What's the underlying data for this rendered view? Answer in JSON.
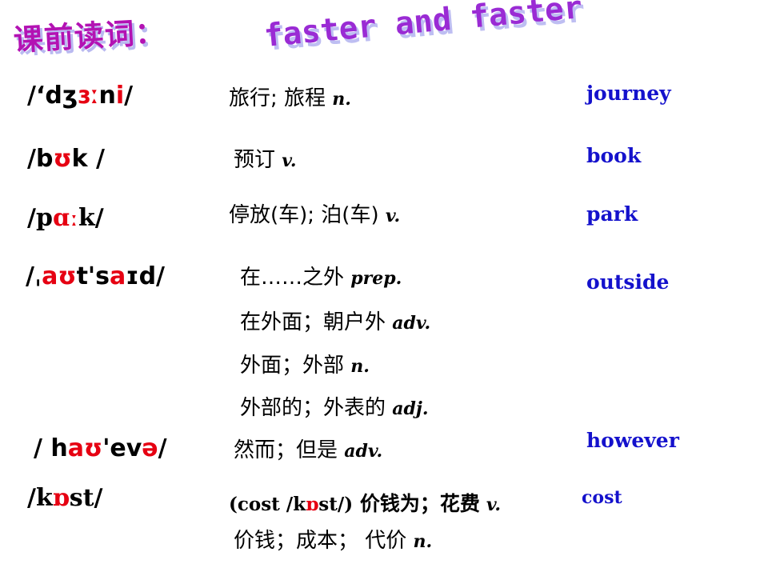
{
  "slide": {
    "background_color": "#ffffff",
    "title": {
      "chinese": "课前读词：",
      "english": "faster and faster",
      "chinese_color": "#B312B3",
      "english_color": "#9A2BD4",
      "shadow_color": "#BEBEF2"
    },
    "colors": {
      "phonetic_black": "#000000",
      "phonetic_highlight_red": "#E60012",
      "word_blue": "#1411CC"
    },
    "entries": [
      {
        "word": "journey",
        "phonetic": "/‘dʒɜːni/",
        "phonetic_segments": [
          {
            "text": "/‘d",
            "color": "black"
          },
          {
            "text": "ʒ",
            "color": "black"
          },
          {
            "text": "ɜː",
            "color": "red"
          },
          {
            "text": "n",
            "color": "black"
          },
          {
            "text": "i",
            "color": "red"
          },
          {
            "text": "/",
            "color": "black"
          }
        ],
        "definitions": [
          {
            "chinese": "旅行; 旅程",
            "pos": "n."
          }
        ]
      },
      {
        "word": "book",
        "phonetic": "/bʊk /",
        "phonetic_segments": [
          {
            "text": "/b",
            "color": "black"
          },
          {
            "text": "ʊ",
            "color": "red"
          },
          {
            "text": "k /",
            "color": "black"
          }
        ],
        "definitions": [
          {
            "chinese": "预订",
            "pos": "v."
          }
        ]
      },
      {
        "word": "park",
        "phonetic": "/pɑːk/",
        "phonetic_segments": [
          {
            "text": "/p",
            "color": "black"
          },
          {
            "text": "ɑː",
            "color": "red"
          },
          {
            "text": "k/",
            "color": "black"
          }
        ],
        "definitions": [
          {
            "chinese": "停放(车); 泊(车)",
            "pos": "v."
          }
        ]
      },
      {
        "word": "outside",
        "phonetic": "/ˌaʊtˈsaɪd/",
        "phonetic_segments": [
          {
            "text": "/ˌ",
            "color": "black"
          },
          {
            "text": "aʊ",
            "color": "red"
          },
          {
            "text": "t's",
            "color": "black"
          },
          {
            "text": "a",
            "color": "red"
          },
          {
            "text": "ɪd/",
            "color": "black"
          }
        ],
        "definitions": [
          {
            "chinese": "在……之外",
            "pos": "prep."
          },
          {
            "chinese": "在外面；朝户外",
            "pos": "adv."
          },
          {
            "chinese": "外面；外部",
            "pos": "n."
          },
          {
            "chinese": "外部的；外表的",
            "pos": "adj."
          }
        ]
      },
      {
        "word": "however",
        "phonetic": "/ haʊˈevə/",
        "phonetic_segments": [
          {
            "text": "/ h",
            "color": "black"
          },
          {
            "text": "aʊ",
            "color": "red"
          },
          {
            "text": "'ev",
            "color": "black"
          },
          {
            "text": "ə",
            "color": "red"
          },
          {
            "text": "/",
            "color": "black"
          }
        ],
        "definitions": [
          {
            "chinese": "然而；但是",
            "pos": "adv."
          }
        ]
      },
      {
        "word": "cost",
        "phonetic": "/kɒst/",
        "phonetic_segments": [
          {
            "text": "/k",
            "color": "black"
          },
          {
            "text": "ɒ",
            "color": "red"
          },
          {
            "text": "st/",
            "color": "black"
          }
        ],
        "definitions": [
          {
            "chinese": "(cost /kɒst/) 价钱为；花费",
            "pos": "v."
          },
          {
            "chinese": "价钱；成本； 代价",
            "pos": "n."
          }
        ],
        "inflection_note": {
          "prefix": "(cost /k",
          "red": "ɒ",
          "suffix": "st/)",
          "chinese": " 价钱为；花费",
          "pos": "v."
        }
      }
    ]
  }
}
